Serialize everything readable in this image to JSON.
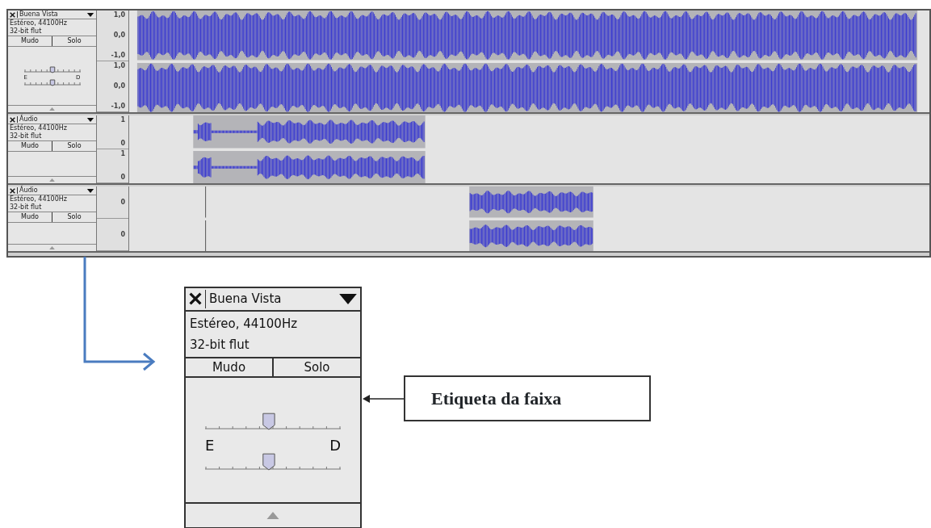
{
  "tracks": [
    {
      "name": "Buena Vista",
      "format": "Estéreo, 44100Hz",
      "bits": "32-bit flut",
      "mute_button": "Mudo",
      "solo_button": "Solo",
      "gain": {
        "level": 0.5
      },
      "pan": {
        "level": 0.5,
        "left_label": "E",
        "right_label": "D"
      },
      "channels": [
        {
          "scale": [
            "1,0",
            "0,0",
            "-1,0"
          ]
        },
        {
          "scale": [
            "1,0",
            "0,0",
            "-1,0"
          ]
        }
      ]
    },
    {
      "name": "Áudio",
      "format": "Estéreo, 44100Hz",
      "bits": "32-bit flut",
      "mute_button": "Mudo",
      "solo_button": "Solo",
      "channels": [
        {
          "scale": [
            "1",
            "0"
          ]
        },
        {
          "scale": [
            "1",
            "0"
          ]
        }
      ]
    },
    {
      "name": "Áudio",
      "format": "Estéreo, 44100Hz",
      "bits": "32-bit flut",
      "mute_button": "Mudo",
      "solo_button": "Solo",
      "channels": [
        {
          "scale": [
            "0"
          ]
        },
        {
          "scale": [
            "0"
          ]
        }
      ]
    }
  ],
  "callout_panel": {
    "name": "Buena Vista",
    "format": "Estéreo, 44100Hz",
    "bits": "32-bit flut",
    "mute_button": "Mudo",
    "solo_button": "Solo",
    "gain": {
      "level": 0.47
    },
    "pan": {
      "level": 0.47,
      "left_label": "E",
      "right_label": "D"
    }
  },
  "annotation": "Etiqueta da faixa"
}
